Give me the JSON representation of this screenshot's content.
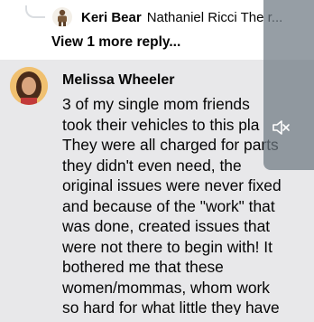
{
  "reply": {
    "author": "Keri Bear",
    "text": "Nathaniel Ricci The r..."
  },
  "view_more": "View 1 more reply...",
  "comment": {
    "author": "Melissa Wheeler",
    "body": "3 of my single mom friends\ntook their vehicles to this pla\nThey were all charged for parts\nthey didn't even need, the\noriginal issues were never fixed\nand because of the \"work\" that\nwas done, created issues that\nwere not there to begin with! It\nbothered me that these\nwomen/mommas, whom work\nso hard for what little they have"
  },
  "video_overlay": {
    "icon": "muted-speaker-icon"
  }
}
